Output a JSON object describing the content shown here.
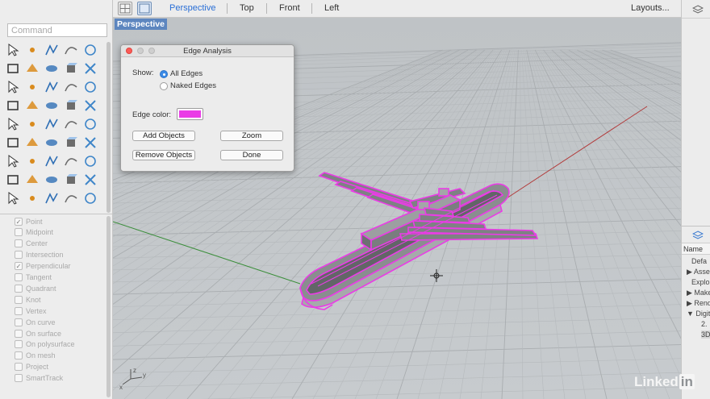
{
  "top_bar": {
    "viewport_tabs": [
      {
        "label": "Perspective",
        "active": true
      },
      {
        "label": "Top",
        "active": false
      },
      {
        "label": "Front",
        "active": false
      },
      {
        "label": "Left",
        "active": false
      }
    ],
    "layouts_label": "Layouts..."
  },
  "command": {
    "placeholder": "Command"
  },
  "toolbar": {
    "icons": [
      "select-arrow-icon",
      "point-icon",
      "polyline-icon",
      "curve-icon",
      "circle-icon",
      "arc-icon",
      "rectangle-icon",
      "ellipse-icon",
      "polygon-icon",
      "freeform-icon",
      "surface-icon",
      "extrude-icon",
      "box-icon",
      "sphere-icon",
      "cylinder-icon",
      "plane-icon",
      "boolean-icon",
      "explode-icon",
      "split-icon",
      "trim-icon",
      "solid-edit-icon",
      "group-icon",
      "fillet-icon",
      "offset-icon",
      "text-icon",
      "array-icon",
      "grid-icon",
      "flow-icon",
      "mesh-icon",
      "render-icon",
      "dimension-icon",
      "analyze-icon",
      "move-icon",
      "rotate-icon",
      "scale-icon",
      "properties-icon",
      "zoom-icon",
      "pan-icon",
      "layers-icon",
      "light-icon",
      "history-icon",
      "car-icon",
      "camera-icon",
      "lightbulb-icon",
      "blocks-icon"
    ]
  },
  "osnaps": [
    {
      "label": "Point",
      "checked": true
    },
    {
      "label": "Midpoint",
      "checked": false
    },
    {
      "label": "Center",
      "checked": false
    },
    {
      "label": "Intersection",
      "checked": false
    },
    {
      "label": "Perpendicular",
      "checked": true
    },
    {
      "label": "Tangent",
      "checked": false
    },
    {
      "label": "Quadrant",
      "checked": false
    },
    {
      "label": "Knot",
      "checked": false
    },
    {
      "label": "Vertex",
      "checked": false
    },
    {
      "label": "On curve",
      "checked": false
    },
    {
      "label": "On surface",
      "checked": false
    },
    {
      "label": "On polysurface",
      "checked": false
    },
    {
      "label": "On mesh",
      "checked": false
    },
    {
      "label": "Project",
      "checked": false
    },
    {
      "label": "SmartTrack",
      "checked": false
    }
  ],
  "viewport": {
    "title": "Perspective"
  },
  "axis_labels": {
    "x": "x",
    "y": "y",
    "z": "z"
  },
  "dialog": {
    "title": "Edge Analysis",
    "show_label": "Show:",
    "options": [
      {
        "label": "All Edges",
        "selected": true
      },
      {
        "label": "Naked Edges",
        "selected": false
      }
    ],
    "edge_color_label": "Edge color:",
    "edge_color": "#ea3ce6",
    "buttons": {
      "add": "Add Objects",
      "zoom": "Zoom",
      "remove": "Remove Objects",
      "done": "Done"
    }
  },
  "right_panel": {
    "name_header": "Name",
    "layers": [
      "Defa",
      "Asse",
      "Explo",
      "Make",
      "Rend",
      "Digita",
      "2.",
      "3D"
    ]
  },
  "colors": {
    "accent": "#2a6fd6",
    "viewport_title_bg": "#5d86bf",
    "edge_highlight": "#ea3ce6"
  },
  "watermark": {
    "text": "Linked",
    "badge": "in"
  }
}
